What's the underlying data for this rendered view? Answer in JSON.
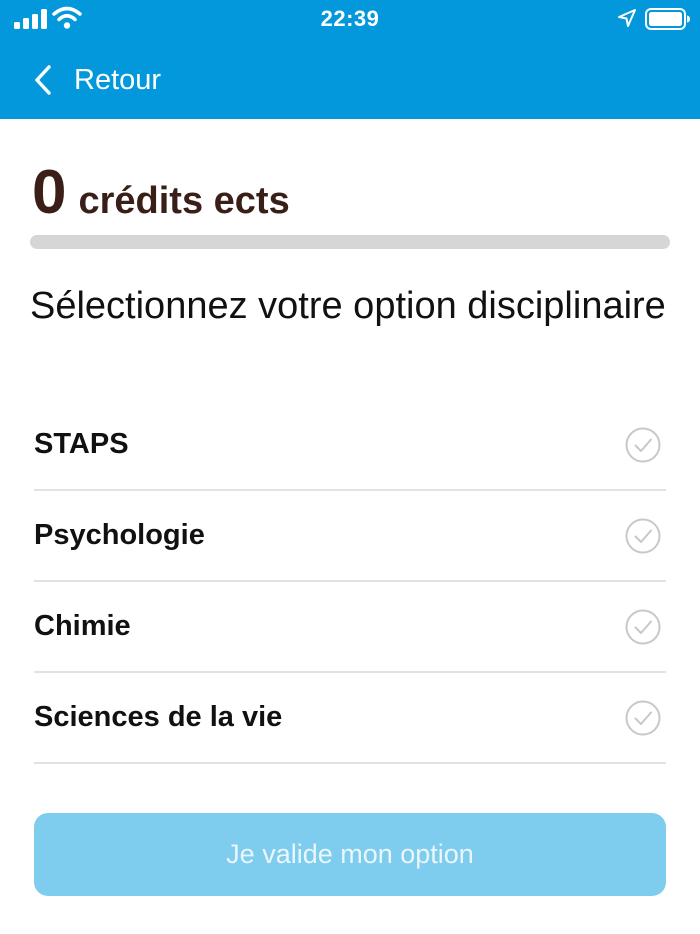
{
  "status_bar": {
    "time": "22:39"
  },
  "nav": {
    "back_label": "Retour"
  },
  "credits": {
    "value": "0",
    "unit": "crédits ects",
    "progress_fraction": 0
  },
  "section": {
    "title": "Sélectionnez votre option disciplinaire"
  },
  "options": [
    {
      "label": "STAPS",
      "selected": false
    },
    {
      "label": "Psychologie",
      "selected": false
    },
    {
      "label": "Chimie",
      "selected": false
    },
    {
      "label": "Sciences de la vie",
      "selected": false
    }
  ],
  "validate_button": {
    "label": "Je valide mon option",
    "enabled": false
  },
  "icons": {
    "signal": "signal-icon",
    "wifi": "wifi-icon",
    "location": "location-arrow-icon",
    "battery": "battery-icon",
    "back": "chevron-left-icon",
    "option_check": "check-circle-icon"
  },
  "colors": {
    "header_background": "#0398dc",
    "credits_text": "#3a1e18",
    "progress_track": "#d6d6d6",
    "button_disabled": "#7ecdee",
    "check_icon": "#c8c8c8"
  }
}
